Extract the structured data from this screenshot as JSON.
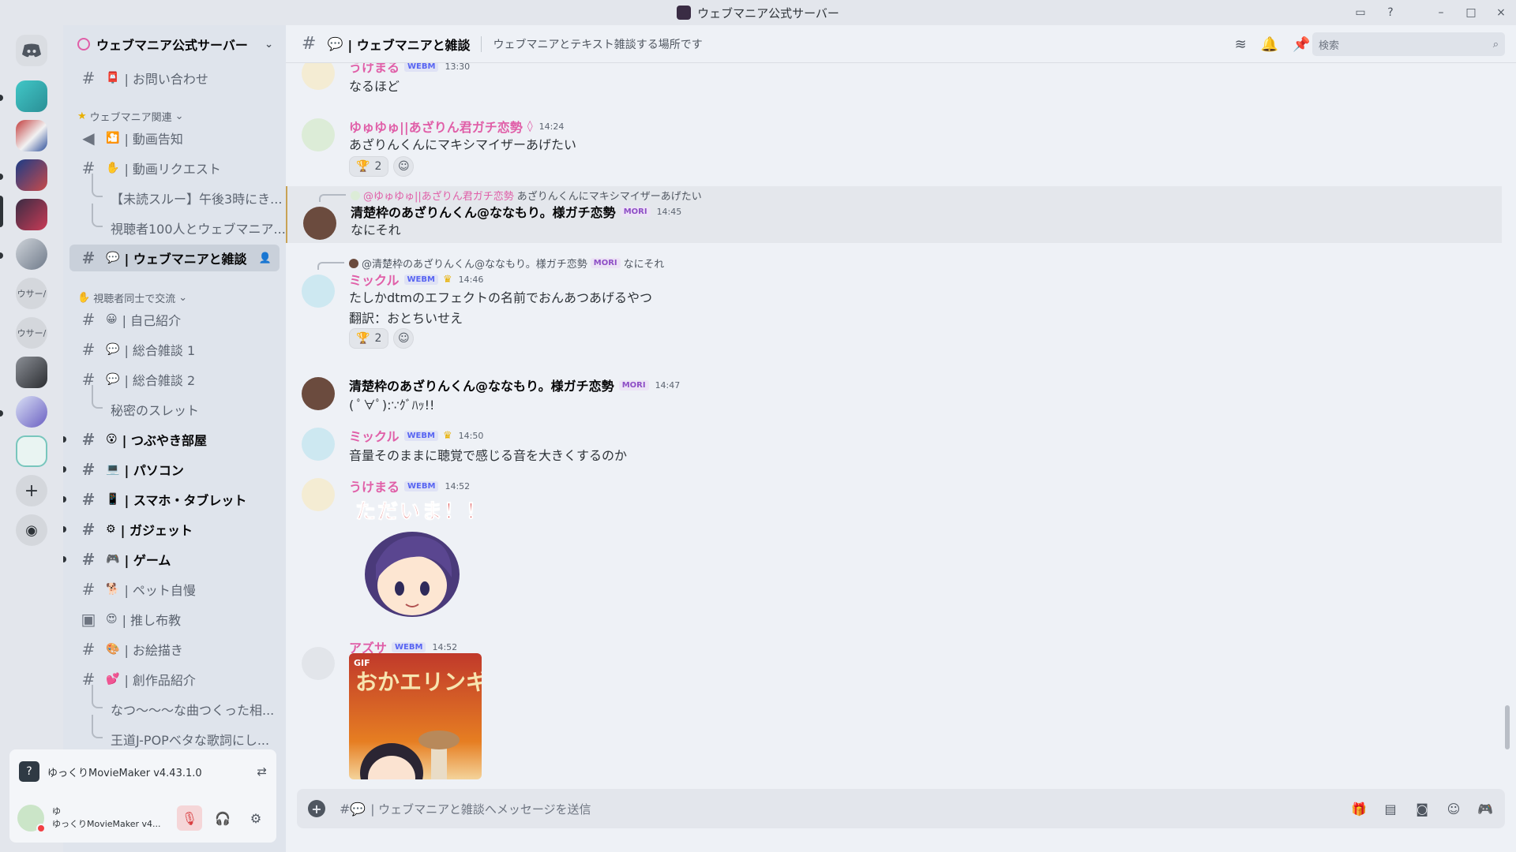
{
  "window": {
    "title": "ウェブマニア公式サーバー",
    "controls": [
      "⎕",
      "?",
      "–",
      "□",
      "×"
    ]
  },
  "servers": {
    "text_items": [
      "ウサー/",
      "ウサー/"
    ]
  },
  "sidebar": {
    "server_name": "ウェブマニア公式サーバー",
    "categories": {
      "webmania": "ウェブマニア関連",
      "viewers": "視聴者同士で交流"
    },
    "channels": [
      {
        "emoji": "📮",
        "label": "| お問い合わせ"
      },
      {
        "emoji": "🎦",
        "label": "| 動画告知"
      },
      {
        "emoji": "✋",
        "label": "| 動画リクエスト"
      },
      {
        "label": "【未読スルー】午後3時にき..."
      },
      {
        "label": "視聴者100人とウェブマニア..."
      },
      {
        "emoji": "💬",
        "label": "| ウェブマニアと雑談"
      },
      {
        "emoji": "😀",
        "label": "| 自己紹介"
      },
      {
        "emoji": "💬",
        "label": "| 総合雑談 1"
      },
      {
        "emoji": "💬",
        "label": "| 総合雑談 2"
      },
      {
        "label": "秘密のスレット"
      },
      {
        "emoji": "😮",
        "label": "| つぶやき部屋"
      },
      {
        "emoji": "💻",
        "label": "| パソコン"
      },
      {
        "emoji": "📱",
        "label": "| スマホ・タブレット"
      },
      {
        "emoji": "⚙",
        "label": "| ガジェット"
      },
      {
        "emoji": "🎮",
        "label": "| ゲーム"
      },
      {
        "emoji": "🐕",
        "label": "| ペット自慢"
      },
      {
        "emoji": "😍",
        "label": "| 推し布教"
      },
      {
        "emoji": "🎨",
        "label": "| お絵描き"
      },
      {
        "emoji": "💕",
        "label": "| 創作品紹介"
      },
      {
        "label": "なつ〜〜〜な曲つくった相..."
      },
      {
        "label": "王道J-POPベタな歌詞にし..."
      }
    ],
    "activity": "ゆっくりMovieMaker v4.43.1.0",
    "user": {
      "name": "ゆ",
      "status": "ゆっくりMovieMaker v4..."
    }
  },
  "chat": {
    "channel_name": "| ウェブマニアと雑談",
    "topic": "ウェブマニアとテキスト雑談する場所です",
    "search_placeholder": "検索",
    "composer_placeholder": "| ウェブマニアと雑談へメッセージを送信"
  },
  "messages": [
    {
      "user": "うけまる",
      "tag": "WEBM",
      "time": "13:30",
      "text": "なるほど"
    },
    {
      "user": "ゆゅゆゅ||あざりん君ガチ恋勢",
      "time": "14:24",
      "text": "あざりんくんにマキシマイザーあげたい",
      "reaction_count": "2"
    },
    {
      "reply_user": "@ゆゅゆゅ||あざりん君ガチ恋勢",
      "reply_text": "あざりんくんにマキシマイザーあげたい",
      "user": "清楚枠のあざりんくん@ななもり。様ガチ恋勢",
      "tag": "MORI",
      "time": "14:45",
      "text": "なにそれ"
    },
    {
      "reply_user": "@清楚枠のあざりんくん@ななもり。様ガチ恋勢",
      "reply_tag": "MORI",
      "reply_text": "なにそれ",
      "user": "ミックル",
      "tag": "WEBM",
      "time": "14:46",
      "text": "たしかdtmのエフェクトの名前でおんあつあげるやつ",
      "text2": "翻訳：おとちいせえ",
      "reaction_count": "2"
    },
    {
      "user": "清楚枠のあざりんくん@ななもり。様ガチ恋勢",
      "tag": "MORI",
      "time": "14:47",
      "text": "( ﾟ∀ﾟ):∵ｸﾞﾊｯ!!"
    },
    {
      "user": "ミックル",
      "tag": "WEBM",
      "time": "14:50",
      "text": "音量そのままに聴覚で感じる音を大きくするのか"
    },
    {
      "user": "うけまる",
      "tag": "WEBM",
      "time": "14:52",
      "sticker_text": "ただいま！！"
    },
    {
      "user": "アズサ",
      "tag": "WEBM",
      "time": "14:52",
      "gif_tag": "GIF",
      "gif_text": "おかエリンギ"
    }
  ],
  "colors": {
    "accent_pink": "#e05fa8",
    "username_pink": "#e05fa8",
    "role_blue": "#5865f2"
  }
}
